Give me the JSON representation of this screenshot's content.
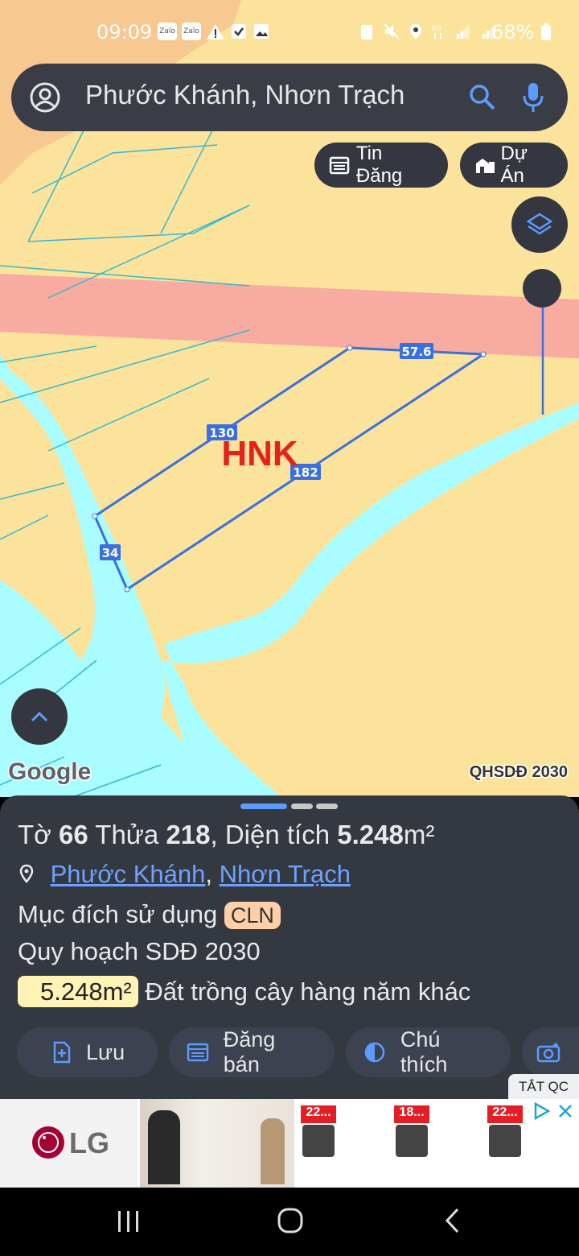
{
  "status_bar": {
    "time": "09:09",
    "battery": "68%",
    "zalo1": "Zalo",
    "zalo2": "Zalo"
  },
  "search": {
    "text": "Phước Khánh, Nhơn Trạch"
  },
  "chips": {
    "tin_dang": "Tin Đăng",
    "du_an": "Dự Án"
  },
  "map": {
    "parcel_label": "HNK",
    "edge_labels": [
      "130",
      "57.6",
      "182",
      "34"
    ],
    "attribution": "Google",
    "layer_label": "QHSDĐ 2030"
  },
  "panel": {
    "to_label": "Tờ",
    "to_value": "66",
    "thua_label": "Thửa",
    "thua_value": "218",
    "dien_tich_label": ", Diện tích",
    "dien_tich_value": "5.248",
    "unit": "m²",
    "location_part1": "Phước Khánh",
    "location_sep": ",",
    "location_part2": "Nhơn Trạch",
    "purpose_label": "Mục đích sử dụng",
    "purpose_badge": "CLN",
    "plan_label": "Quy hoạch SDĐ 2030",
    "plan_area": "5.248m²",
    "plan_desc": "Đất trồng cây hàng năm khác"
  },
  "actions": {
    "save": "Lưu",
    "post": "Đăng bán",
    "legend": "Chú thích"
  },
  "ad": {
    "close_label": "TẮT QC",
    "brand": "LG",
    "prices": [
      "22...",
      "18...",
      "22..."
    ]
  },
  "colors": {
    "land": "#fbe39b",
    "water": "#a9fcff",
    "road": "#f8aba0",
    "parcel": "#3a6fe0",
    "panel": "#343840",
    "accent": "#5b9cff"
  }
}
